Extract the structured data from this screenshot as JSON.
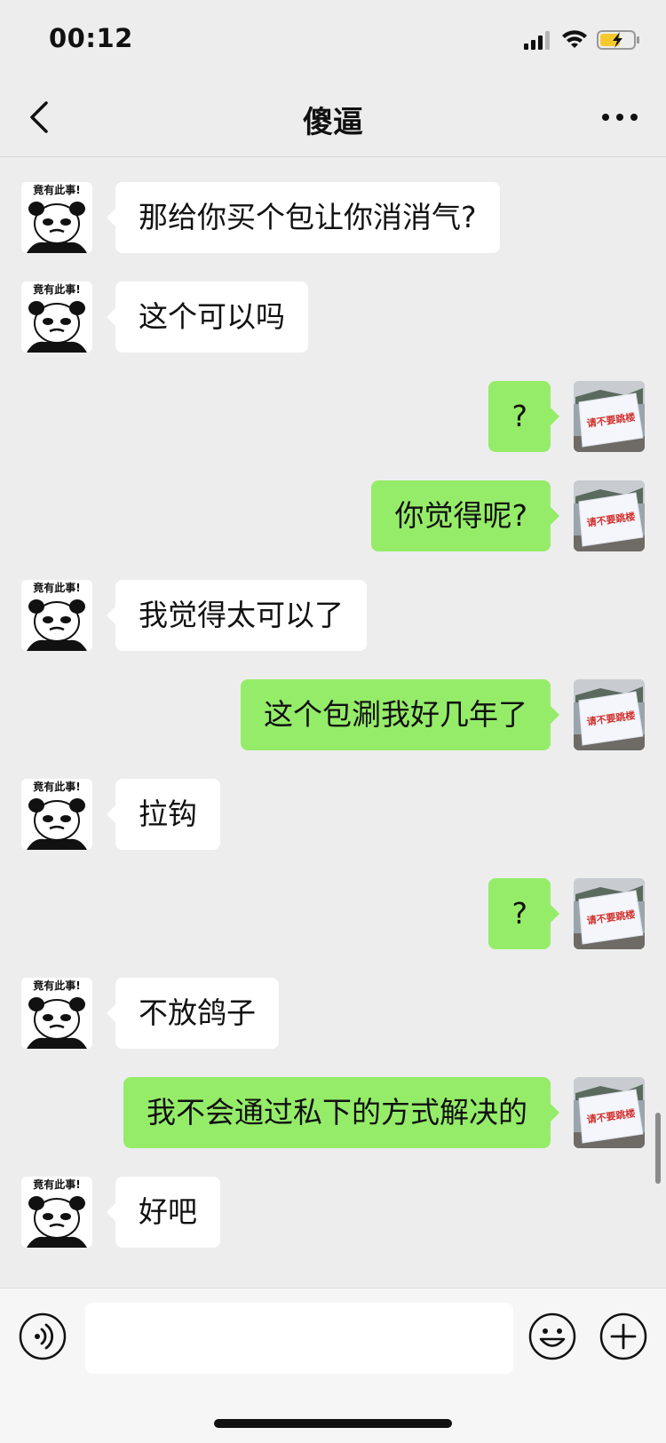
{
  "status_bar": {
    "time": "00:12"
  },
  "header": {
    "title": "傻逼"
  },
  "avatars": {
    "contact_caption": "竟有此事!",
    "self_caption": "请不要跳楼"
  },
  "messages": [
    {
      "side": "in",
      "text": "那给你买个包让你消消气?"
    },
    {
      "side": "in",
      "text": "这个可以吗"
    },
    {
      "side": "out",
      "text": "?"
    },
    {
      "side": "out",
      "text": "你觉得呢?"
    },
    {
      "side": "in",
      "text": "我觉得太可以了"
    },
    {
      "side": "out",
      "text": "这个包涮我好几年了"
    },
    {
      "side": "in",
      "text": "拉钩"
    },
    {
      "side": "out",
      "text": "?"
    },
    {
      "side": "in",
      "text": "不放鸽子"
    },
    {
      "side": "out",
      "text": "我不会通过私下的方式解决的"
    },
    {
      "side": "in",
      "text": "好吧"
    }
  ],
  "input": {
    "value": ""
  },
  "colors": {
    "background": "#ededed",
    "incoming_bubble": "#ffffff",
    "outgoing_bubble": "#95ec69",
    "battery": "#f5c92b"
  }
}
